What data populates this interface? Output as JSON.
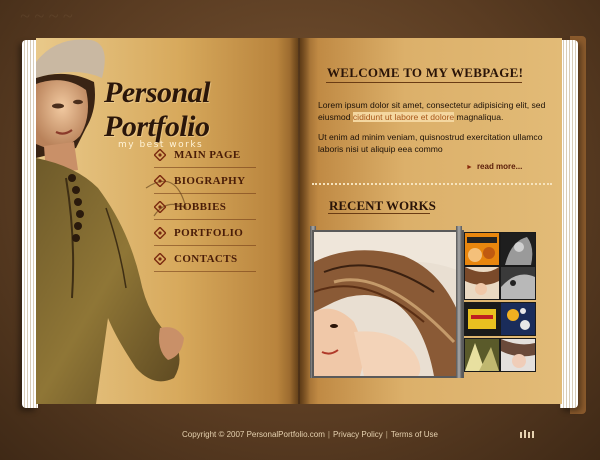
{
  "logo": {
    "title": "Personal Portfolio",
    "subtitle": "my best works"
  },
  "nav": [
    {
      "label": "MAIN PAGE"
    },
    {
      "label": "BIOGRAPHY"
    },
    {
      "label": "HOBBIES"
    },
    {
      "label": "PORTFOLIO"
    },
    {
      "label": "CONTACTS"
    }
  ],
  "welcome": {
    "heading": "WELCOME TO MY WEBPAGE!",
    "p1_before": "Lorem ipsum dolor sit amet, consectetur adipisicing elit, sed  eiusmod ",
    "p1_highlight": "cididunt ut labore et dolore",
    "p1_after": " magnaliqua.",
    "p2": "Ut enim ad minim veniam, quisnostrud exercitation ullamco laboris nisi ut aliquip eea commo",
    "read_more": "read more..."
  },
  "recent_works": {
    "heading": "RECENT WORKS"
  },
  "footer": {
    "copyright": "Copyright © 2007 PersonalPortfolio.com",
    "privacy": "Privacy Policy",
    "terms": "Terms of Use"
  },
  "colors": {
    "accent": "#4a1d08",
    "highlight": "#a8571a",
    "page": "#dcb06a"
  }
}
